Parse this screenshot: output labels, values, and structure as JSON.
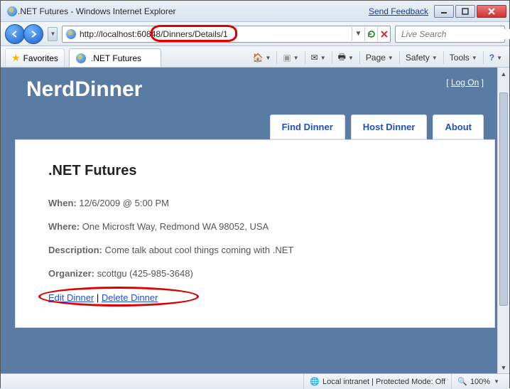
{
  "window": {
    "title": ".NET Futures - Windows Internet Explorer",
    "feedback": "Send Feedback"
  },
  "address": {
    "url": "http://localhost:60848/Dinners/Details/1"
  },
  "search": {
    "placeholder": "Live Search"
  },
  "favorites": {
    "label": "Favorites"
  },
  "tab": {
    "label": ".NET Futures"
  },
  "cmd": {
    "page": "Page",
    "safety": "Safety",
    "tools": "Tools"
  },
  "site": {
    "logo": "NerdDinner",
    "logon_prefix": "[ ",
    "logon": "Log On",
    "logon_suffix": " ]",
    "nav": {
      "find": "Find Dinner",
      "host": "Host Dinner",
      "about": "About"
    }
  },
  "dinner": {
    "title": ".NET Futures",
    "when_label": "When:",
    "when": "12/6/2009 @ 5:00 PM",
    "where_label": "Where:",
    "where": "One Microsft Way, Redmond WA 98052, USA",
    "desc_label": "Description:",
    "desc": "Come talk about cool things coming with .NET",
    "org_label": "Organizer:",
    "org": "scottgu (425-985-3648)",
    "edit": "Edit Dinner",
    "sep": " | ",
    "delete": "Delete Dinner"
  },
  "status": {
    "zone": "Local intranet | Protected Mode: Off",
    "zoom": "100%"
  }
}
